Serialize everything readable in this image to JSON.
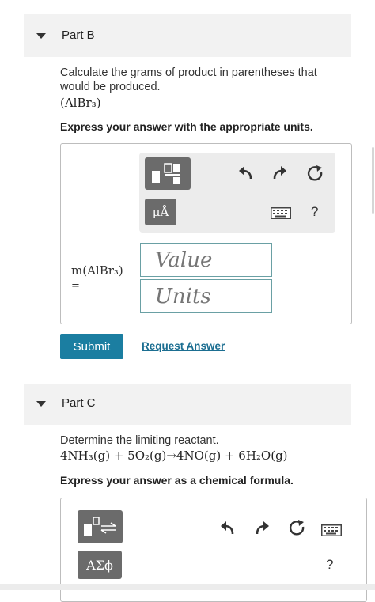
{
  "part_b": {
    "title": "Part B",
    "question": "Calculate the grams of product in parentheses that would be produced.",
    "formula": "(AlBr₃)",
    "instruction": "Express your answer with the appropriate units.",
    "toolbar_units_label": "μÅ",
    "help_label": "?",
    "var_label": "m(AlBr₃)",
    "var_equals": "=",
    "value_placeholder": "Value",
    "units_placeholder": "Units",
    "submit_label": "Submit",
    "request_label": "Request Answer"
  },
  "part_c": {
    "title": "Part C",
    "question": "Determine the limiting reactant.",
    "equation": "4NH₃(g) + 5O₂(g)→4NO(g) + 6H₂O(g)",
    "instruction": "Express your answer as a chemical formula.",
    "toolbar_greek_label": "ΑΣϕ",
    "help_label": "?"
  },
  "colors": {
    "accent": "#1b7ea1",
    "toolbar_button": "#6b6b6b",
    "header_bg": "#f2f2f2"
  }
}
